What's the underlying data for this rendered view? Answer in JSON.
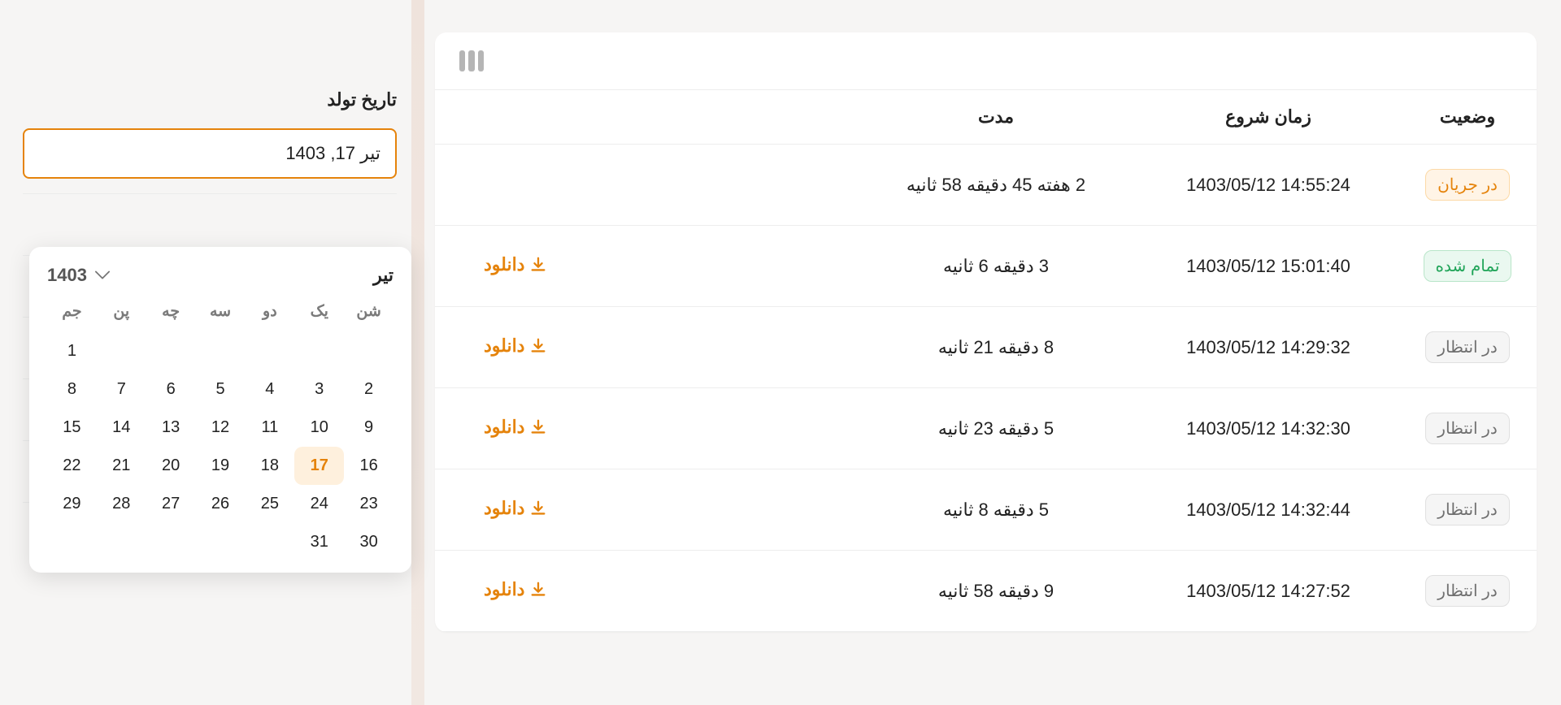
{
  "side": {
    "field_label": "تاریخ تولد",
    "date_value": "تیر 17, 1403"
  },
  "datepicker": {
    "month": "تیر",
    "year": "1403",
    "weekdays": [
      "شن",
      "یک",
      "دو",
      "سه",
      "چه",
      "پن",
      "جم"
    ],
    "grid": [
      [
        "",
        "",
        "",
        "",
        "",
        "",
        "1"
      ],
      [
        "2",
        "3",
        "4",
        "5",
        "6",
        "7",
        "8"
      ],
      [
        "9",
        "10",
        "11",
        "12",
        "13",
        "14",
        "15"
      ],
      [
        "16",
        "17",
        "18",
        "19",
        "20",
        "21",
        "22"
      ],
      [
        "23",
        "24",
        "25",
        "26",
        "27",
        "28",
        "29"
      ],
      [
        "30",
        "31",
        "",
        "",
        "",
        "",
        ""
      ]
    ],
    "selected": "17"
  },
  "table": {
    "headers": {
      "status": "وضعیت",
      "start": "زمان شروع",
      "duration": "مدت"
    },
    "download_label": "دانلود",
    "rows": [
      {
        "status_key": "running",
        "status": "در جریان",
        "start": "1403/05/12 14:55:24",
        "duration": "2 هفته 45 دقیقه 58 ثانیه",
        "download": false
      },
      {
        "status_key": "done",
        "status": "تمام شده",
        "start": "1403/05/12 15:01:40",
        "duration": "3 دقیقه 6 ثانیه",
        "download": true
      },
      {
        "status_key": "waiting",
        "status": "در انتظار",
        "start": "1403/05/12 14:29:32",
        "duration": "8 دقیقه 21 ثانیه",
        "download": true
      },
      {
        "status_key": "waiting",
        "status": "در انتظار",
        "start": "1403/05/12 14:32:30",
        "duration": "5 دقیقه 23 ثانیه",
        "download": true
      },
      {
        "status_key": "waiting",
        "status": "در انتظار",
        "start": "1403/05/12 14:32:44",
        "duration": "5 دقیقه 8 ثانیه",
        "download": true
      },
      {
        "status_key": "waiting",
        "status": "در انتظار",
        "start": "1403/05/12 14:27:52",
        "duration": "9 دقیقه 58 ثانیه",
        "download": true
      }
    ]
  }
}
